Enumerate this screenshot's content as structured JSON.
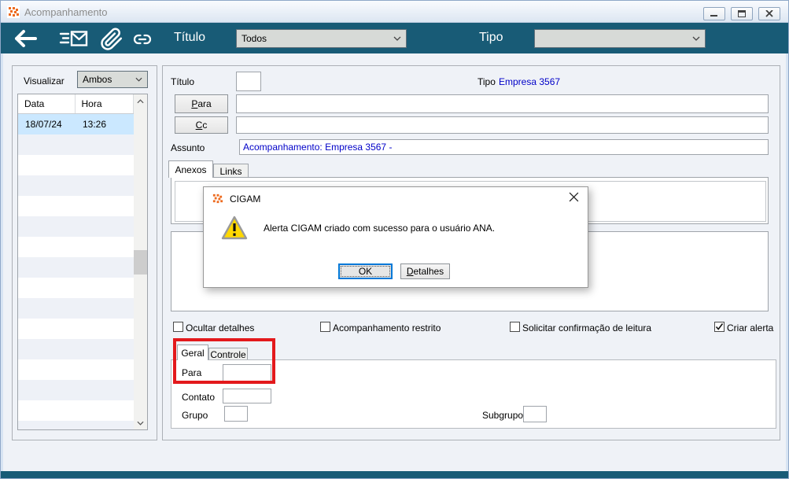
{
  "window": {
    "title": "Acompanhamento"
  },
  "toolbar": {
    "titulo_label": "Título",
    "titulo_filter_value": "Todos",
    "tipo_label": "Tipo",
    "tipo_filter_value": "",
    "icons": [
      "back-arrow-icon",
      "send-message-icon",
      "paperclip-icon",
      "link-icon"
    ]
  },
  "left_panel": {
    "visualizar_label": "Visualizar",
    "visualizar_value": "Ambos",
    "list": {
      "columns": [
        "Data",
        "Hora"
      ],
      "rows": [
        {
          "data": "18/07/24",
          "hora": "13:26",
          "selected": true
        }
      ]
    }
  },
  "form": {
    "titulo_label": "Título",
    "titulo_value": "",
    "tipo_label": "Tipo",
    "tipo_value": "Empresa 3567",
    "para_button_label": "Para",
    "para_value": "",
    "cc_button_label": "Cc",
    "cc_value": "",
    "assunto_label": "Assunto",
    "assunto_value": "Acompanhamento: Empresa 3567 -",
    "attachment_tabs": [
      {
        "label": "Anexos",
        "active": true
      },
      {
        "label": "Links",
        "active": false
      }
    ],
    "checkboxes": [
      {
        "label": "Ocultar detalhes",
        "checked": false
      },
      {
        "label": "Acompanhamento restrito",
        "checked": false
      },
      {
        "label": "Solicitar confirmação de leitura",
        "checked": false
      },
      {
        "label": "Criar alerta",
        "checked": true
      }
    ],
    "detail_tabs": [
      {
        "label": "Geral",
        "active": true
      },
      {
        "label": "Controle",
        "active": false
      }
    ],
    "detail_fields": {
      "para_label": "Para",
      "para_value": "",
      "contato_label": "Contato",
      "contato_value": "",
      "grupo_label": "Grupo",
      "grupo_value": "",
      "subgrupo_label": "Subgrupo",
      "subgrupo_value": ""
    }
  },
  "dialog": {
    "title": "CIGAM",
    "message": "Alerta CIGAM criado com sucesso para o usuário ANA.",
    "ok_label": "OK",
    "detalhes_label": "Detalhes"
  },
  "colors": {
    "accent_teal": "#185B76",
    "selection_blue": "#CBE8FF",
    "link_blue": "#0000C8",
    "annotation_red": "#E3191C",
    "warning_yellow": "#FFD800"
  }
}
